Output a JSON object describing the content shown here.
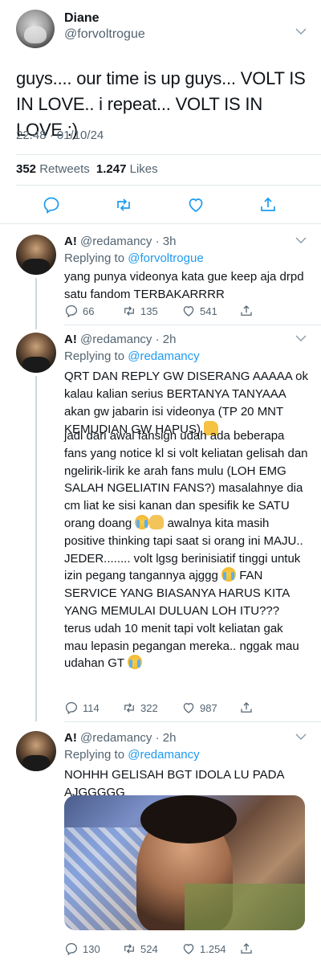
{
  "main_tweet": {
    "author_name": "Diane",
    "author_handle": "@forvoltrogue",
    "text": "guys.... our time is up guys... VOLT IS IN LOVE.. i repeat... VOLT IS IN LOVE :)",
    "timestamp": "22.48 · 01/10/24",
    "retweets_count": "352",
    "retweets_label": "Retweets",
    "likes_count": "1.247",
    "likes_label": "Likes"
  },
  "replies": [
    {
      "author_name": "A!",
      "author_handle": "@redamancy · 3h",
      "replying_prefix": "Replying to",
      "replying_to": "@forvoltrogue",
      "text": "yang punya videonya kata gue keep aja drpd satu fandom TERBAKARRRR",
      "replies_count": "66",
      "retweets_count": "135",
      "likes_count": "541"
    },
    {
      "author_name": "A!",
      "author_handle": "@redamancy · 2h",
      "replying_prefix": "Replying to",
      "replying_to": "@redamancy",
      "paragraph_1": "QRT DAN REPLY GW DISERANG AAAAA ok kalau kalian serius BERTANYA TANYAAA akan gw jabarin isi videonya (TP 20 MNT KEMUDIAN GW HAPUS)",
      "paragraph_2a": "jadi dari awal fansign udah ada beberapa fans yang notice kl si volt keliatan gelisah dan ngelirik-lirik ke arah fans mulu (LOH EMG SALAH NGELIATIN FANS?) masalahnye dia cm liat ke sisi kanan dan spesifik ke SATU orang doang",
      "paragraph_2b": "awalnya kita masih positive thinking tapi saat si orang ini MAJU.. JEDER........ volt lgsg berinisiatif tinggi untuk izin pegang tangannya ajggg",
      "paragraph_2c": "FAN SERVICE YANG BIASANYA HARUS KITA YANG MEMULAI DULUAN LOH ITU??? terus udah 10 menit tapi volt keliatan gak mau lepasin pegangan mereka.. nggak mau udahan GT",
      "replies_count": "114",
      "retweets_count": "322",
      "likes_count": "987"
    },
    {
      "author_name": "A!",
      "author_handle": "@redamancy · 2h",
      "replying_prefix": "Replying to",
      "replying_to": "@redamancy",
      "text": "NOHHH GELISAH BGT IDOLA LU PADA AJGGGGG",
      "replies_count": "130",
      "retweets_count": "524",
      "likes_count": "1.254"
    }
  ],
  "icons": {
    "reply": "reply-icon",
    "retweet": "retweet-icon",
    "like": "heart-icon",
    "share": "share-icon",
    "more": "chevron-down-icon"
  },
  "colors": {
    "link": "#1d9bf0",
    "secondary_text": "#536471",
    "action_icon": "#1d9bf0"
  }
}
